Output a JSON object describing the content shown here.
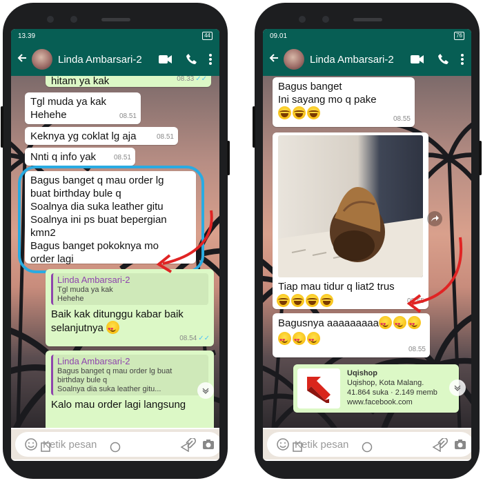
{
  "left": {
    "status": {
      "time": "13.39",
      "signal": ".ıl",
      "battery": "44"
    },
    "header": {
      "contact": "Linda Ambarsari-2"
    },
    "messages": {
      "m0": {
        "text": "hitam ya kak",
        "time": "08.33",
        "ticks": "✓✓"
      },
      "m1": {
        "line1": "Tgl muda ya kak",
        "line2": "Hehehe",
        "time": "08.51"
      },
      "m2": {
        "text": "Keknya yg coklat lg aja",
        "time": "08.51"
      },
      "m3": {
        "text": "Nnti q info yak",
        "time": "08.51"
      },
      "m4": {
        "line1": "Bagus banget q mau order lg",
        "line2": "buat birthday bule q",
        "line3": "Soalnya dia suka leather gitu",
        "line4": "Soalnya ini ps buat bepergian",
        "line5": "kmn2",
        "line6": "Bagus banget pokoknya mo",
        "line7": "order lagi"
      },
      "m5": {
        "quote_name": "Linda Ambarsari-2",
        "quote_line1": "Tgl muda ya kak",
        "quote_line2": "Hehehe",
        "line1": "Baik kak ditunggu kabar baik",
        "line2": "selanjutnya",
        "time": "08.54",
        "ticks": "✓✓"
      },
      "m6": {
        "quote_name": "Linda Ambarsari-2",
        "quote_line1": "Bagus banget q mau order lg buat",
        "quote_line2": "birthday bule q",
        "quote_line3": "Soalnya dia suka leather gitu...",
        "text": "Kalo mau order lagi langsung"
      }
    },
    "input": {
      "placeholder": "Ketik pesan"
    }
  },
  "right": {
    "status": {
      "time": "09.01",
      "signal": ".ıl",
      "battery": "76"
    },
    "header": {
      "contact": "Linda Ambarsari-2"
    },
    "messages": {
      "m1": {
        "line1": "Bagus banget",
        "line2": "Ini sayang mo q pake",
        "time": "08.55"
      },
      "m2": {
        "caption": "Tiap mau tidur q liat2 trus",
        "time": "08.55"
      },
      "m3": {
        "text": "Bagusnya aaaaaaaaa",
        "time": "08.55"
      },
      "m4": {
        "title": "Uqishop",
        "line1": "Uqishop, Kota Malang.",
        "line2": "41.864 suka · 2.149 memb",
        "line3": "www.facebook.com"
      }
    },
    "input": {
      "placeholder": "Ketik pesan"
    }
  },
  "colors": {
    "header": "#075e54",
    "outgoing": "#dcf8c6",
    "annotation_ellipse": "#29abe2",
    "annotation_arrow": "#e02424",
    "mic": "#00897b"
  },
  "icons": [
    "back-arrow-icon",
    "video-call-icon",
    "phone-icon",
    "more-vert-icon",
    "emoji-icon",
    "attach-icon",
    "camera-icon",
    "mic-icon",
    "forward-icon",
    "chevron-down-icon",
    "nav-recent-icon",
    "nav-home-icon",
    "nav-back-icon"
  ]
}
